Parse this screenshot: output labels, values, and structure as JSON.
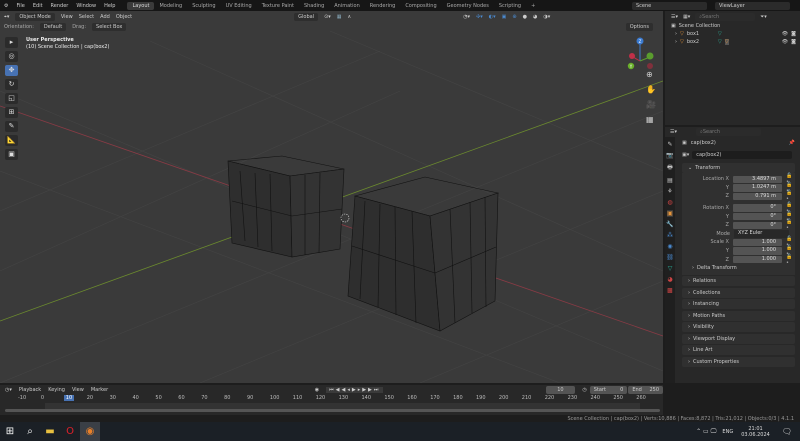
{
  "menu": [
    "File",
    "Edit",
    "Render",
    "Window",
    "Help"
  ],
  "workspaces": [
    "Layout",
    "Modeling",
    "Sculpting",
    "UV Editing",
    "Texture Paint",
    "Shading",
    "Animation",
    "Rendering",
    "Compositing",
    "Geometry Nodes",
    "Scripting"
  ],
  "active_workspace": "Layout",
  "scene": "Scene",
  "view_layer": "ViewLayer",
  "viewport": {
    "mode": "Object Mode",
    "menus": [
      "View",
      "Select",
      "Add",
      "Object"
    ],
    "transform_orientation": "Global",
    "orientation_label": "Orientation:",
    "orientation": "Default",
    "drag_label": "Drag:",
    "drag": "Select Box",
    "options": "Options",
    "perspective": "User Perspective",
    "collection_info": "(10) Scene Collection | cap(box2)",
    "gizmo": {
      "z": "Z",
      "y": "Y"
    }
  },
  "outliner": {
    "search_placeholder": "Search",
    "root": "Scene Collection",
    "items": [
      {
        "name": "box1"
      },
      {
        "name": "box2"
      }
    ]
  },
  "properties": {
    "search_placeholder": "Search",
    "object_name": "cap(box2)",
    "data_name": "cap(box2)",
    "transform_title": "Transform",
    "location": {
      "label": "Location X",
      "x": "3.4897 m",
      "y": "1.0247 m",
      "z": "0.791 m"
    },
    "rotation": {
      "label": "Rotation X",
      "x": "0°",
      "y": "0°",
      "z": "0°"
    },
    "mode_label": "Mode",
    "mode": "XYZ Euler",
    "scale": {
      "label": "Scale X",
      "x": "1.000",
      "y": "1.000",
      "z": "1.000"
    },
    "axis_y": "Y",
    "axis_z": "Z",
    "delta": "Delta Transform",
    "panels": [
      "Relations",
      "Collections",
      "Instancing",
      "Motion Paths",
      "Visibility",
      "Viewport Display",
      "Line Art",
      "Custom Properties"
    ]
  },
  "timeline": {
    "menus": [
      "Playback",
      "Keying",
      "View",
      "Marker"
    ],
    "current_frame": "10",
    "start_label": "Start",
    "start": "0",
    "end_label": "End",
    "end": "250",
    "ticks": [
      "-10",
      "0",
      "10",
      "20",
      "30",
      "40",
      "50",
      "60",
      "70",
      "80",
      "90",
      "100",
      "110",
      "120",
      "130",
      "140",
      "150",
      "160",
      "170",
      "180",
      "190",
      "200",
      "210",
      "220",
      "230",
      "240",
      "250",
      "260"
    ]
  },
  "status": "Scene Collection | cap(box2) | Verts:10,886 | Faces:8,872 | Tris:21,012 | Objects:0/3 | 4.1.1",
  "taskbar": {
    "lang": "ENG",
    "time": "21:01",
    "date": "03.06.2024"
  }
}
